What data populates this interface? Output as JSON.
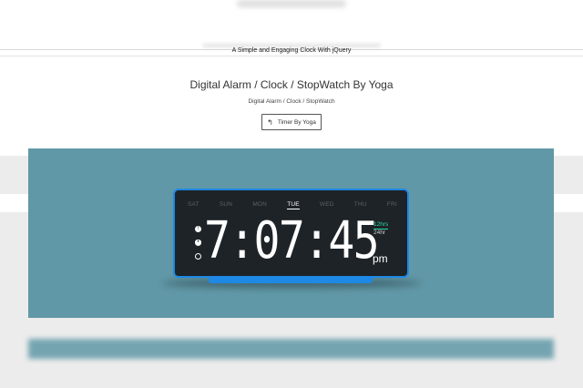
{
  "header": {
    "tagline": "A Simple and Engaging Clock With jQuery"
  },
  "content": {
    "title": "Digital Alarm / Clock / StopWatch By Yoga",
    "breadcrumb": "Digital Alarm / Clock / StopWatch",
    "button_label": "Timer By Yoga"
  },
  "clock": {
    "days": [
      "SAT",
      "SUN",
      "MON",
      "TUE",
      "WED",
      "THU",
      "FRI"
    ],
    "active_day": "TUE",
    "time": "7:07:45",
    "ampm": "pm",
    "format_12": "12hrs",
    "format_24": "24hr",
    "accent_color": "#1e88e5",
    "active_format_color": "#2bd9a6",
    "stage_color": "#6198a7"
  },
  "icons": {
    "button_icon": "reply-arrow-icon",
    "side": [
      "alarm-icon",
      "bell-icon",
      "clock-icon"
    ]
  }
}
